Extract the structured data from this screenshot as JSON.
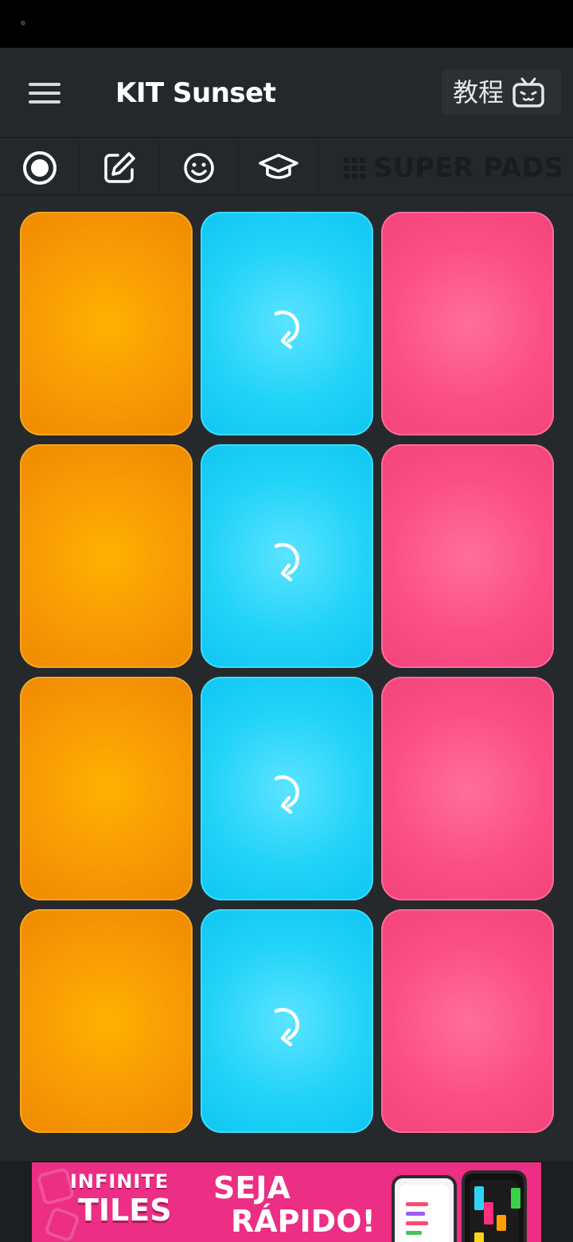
{
  "header": {
    "title": "KIT Sunset",
    "tutorial_label": "教程"
  },
  "toolbar": {
    "items": [
      {
        "name": "record",
        "icon": "record-icon"
      },
      {
        "name": "edit",
        "icon": "pencil-edit-icon"
      },
      {
        "name": "emoji",
        "icon": "smiley-icon"
      },
      {
        "name": "learn",
        "icon": "graduation-cap-icon"
      }
    ],
    "brand_label": "SUPER PADS"
  },
  "pads": {
    "columns": [
      "orange",
      "cyan",
      "pink"
    ],
    "rows": 4,
    "colors": {
      "orange": "#f79a05",
      "cyan": "#22d3f8",
      "pink": "#fb4f86"
    },
    "cyan_icon": "loop-arrow-icon"
  },
  "ad": {
    "line1": "INFINITE",
    "line2": "TILES",
    "cta_line1": "SEJA",
    "cta_line2": "RÁPIDO!",
    "background": "#ec2e84"
  }
}
